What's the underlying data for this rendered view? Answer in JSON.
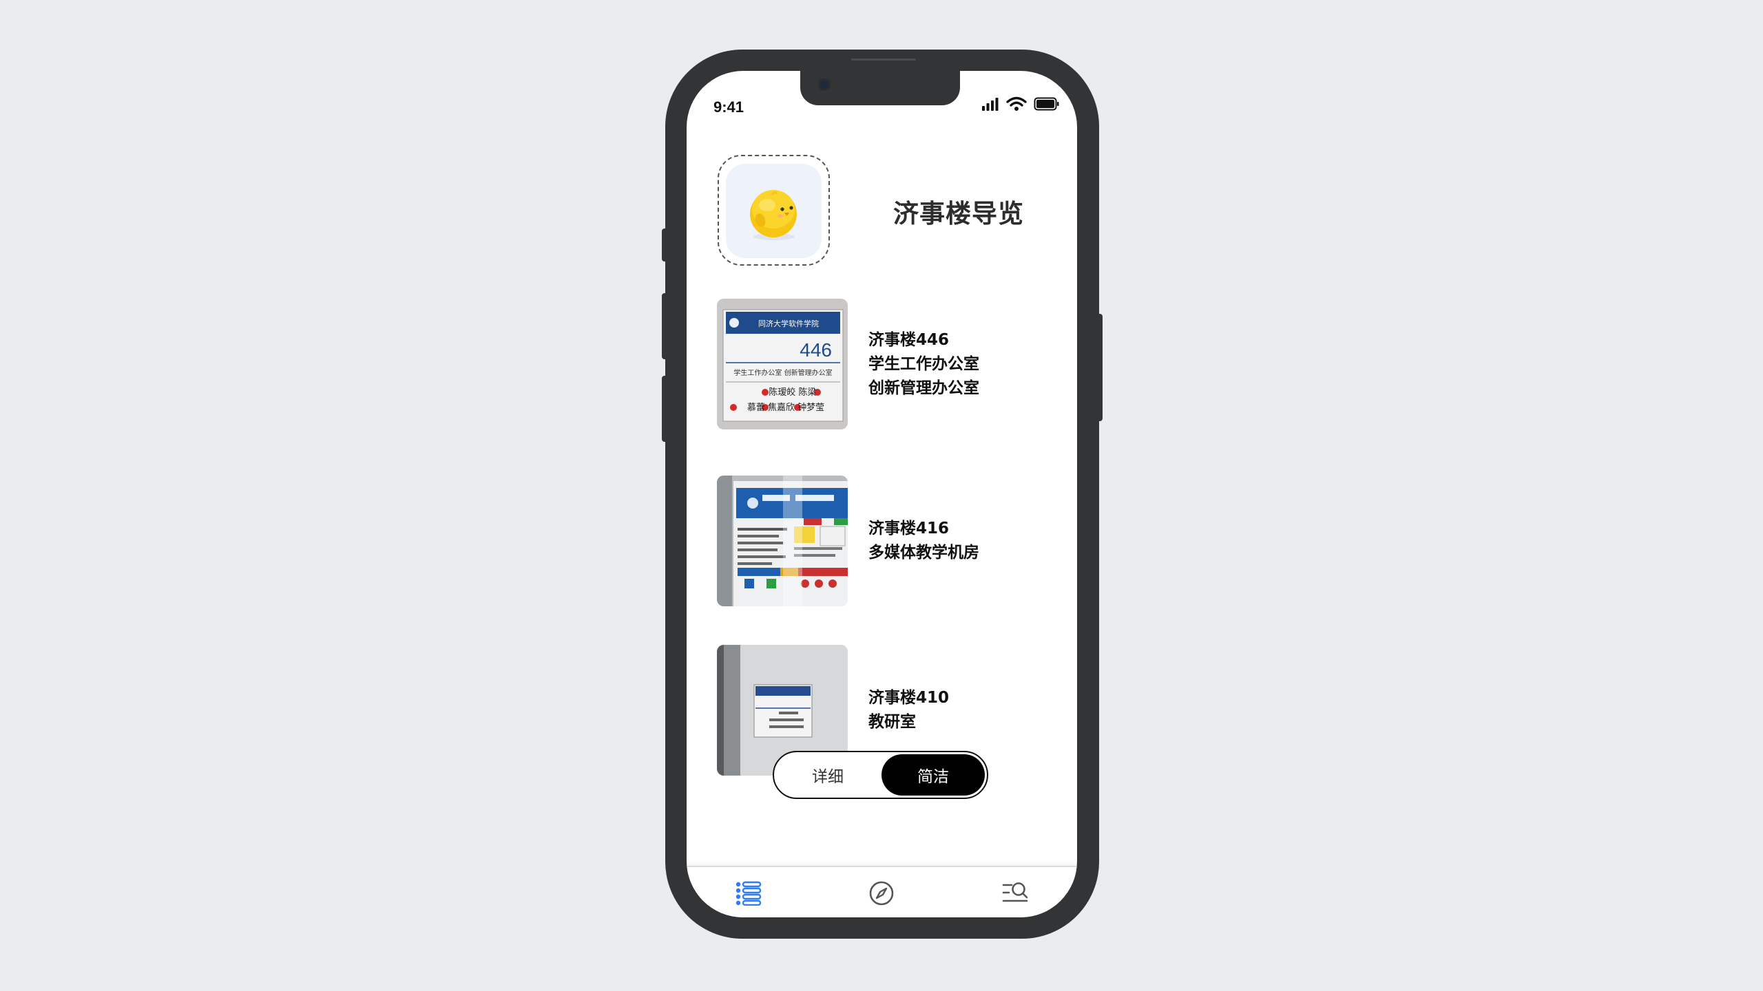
{
  "status_bar": {
    "time": "9:41"
  },
  "header": {
    "title": "济事楼导览",
    "logo_icon": "chick-mascot-icon"
  },
  "rooms": [
    {
      "lines": [
        "济事楼446",
        "学生工作办公室",
        "创新管理办公室"
      ],
      "photo_icon": "door-sign-photo-446",
      "photo_text": {
        "header": "同济大学软件学院",
        "number": "446",
        "rooms": "学生工作办公室  创新管理办公室",
        "names_1": "陈瑷皎  陈梁",
        "names_2": "慕蕾 焦嘉欣 钟梦莹"
      }
    },
    {
      "lines": [
        "济事楼416",
        "多媒体教学机房"
      ],
      "photo_icon": "lab-info-board-photo-416"
    },
    {
      "lines": [
        "济事楼410",
        "教研室"
      ],
      "photo_icon": "door-sign-photo-410"
    }
  ],
  "view_toggle": {
    "options": [
      "详细",
      "简洁"
    ],
    "selected": "简洁"
  },
  "tabbar": {
    "tabs": [
      {
        "icon": "list-icon",
        "active": true
      },
      {
        "icon": "compass-icon",
        "active": false
      },
      {
        "icon": "search-list-icon",
        "active": false
      }
    ]
  },
  "colors": {
    "accent": "#2f7df6",
    "background": "#ebecee",
    "phone_frame": "#333436"
  }
}
